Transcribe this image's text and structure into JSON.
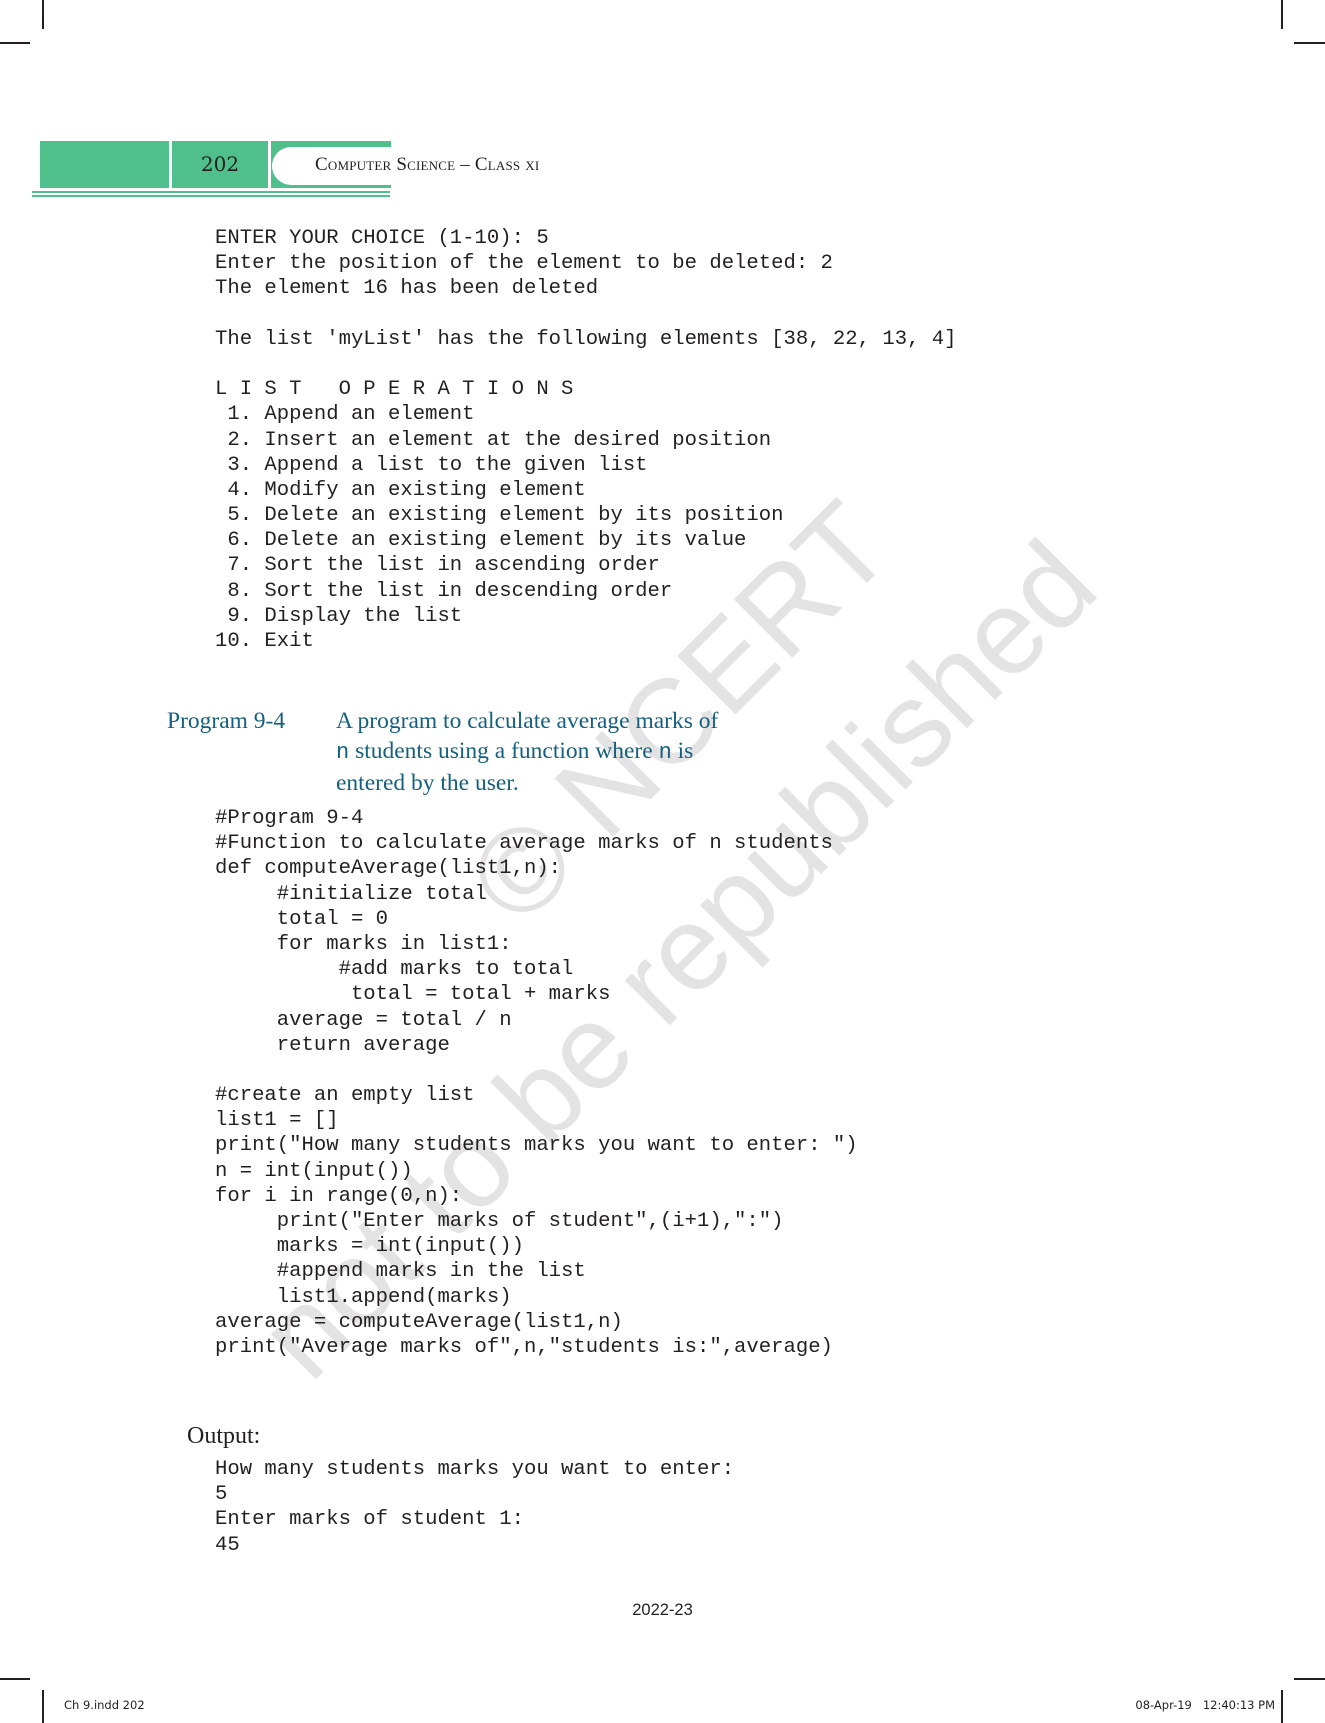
{
  "header": {
    "page_number": "202",
    "running_title": "Computer Science – Class xi",
    "band_color": "#4fbf8c"
  },
  "top_output": {
    "lines": [
      "ENTER YOUR CHOICE (1-10): 5",
      "Enter the position of the element to be deleted: 2",
      "The element 16 has been deleted",
      "",
      "The list 'myList' has the following elements [38, 22, 13, 4]",
      "",
      "L I S T   O P E R A T I O N S",
      " 1. Append an element",
      " 2. Insert an element at the desired position",
      " 3. Append a list to the given list",
      " 4. Modify an existing element",
      " 5. Delete an existing element by its position",
      " 6. Delete an existing element by its value",
      " 7. Sort the list in ascending order",
      " 8. Sort the list in descending order",
      " 9. Display the list",
      "10. Exit"
    ]
  },
  "program": {
    "label": "Program 9-4",
    "caption_color": "#14607f",
    "caption_line1": "A program to calculate average marks of",
    "caption_line2_code1": "n",
    "caption_line2_mid": " students using a function where ",
    "caption_line2_code2": "n",
    "caption_line2_end": " is",
    "caption_line3": "entered by the user."
  },
  "code": {
    "lines": [
      "#Program 9-4",
      "#Function to calculate average marks of n students",
      "def computeAverage(list1,n):",
      "     #initialize total",
      "     total = 0",
      "     for marks in list1:",
      "          #add marks to total",
      "           total = total + marks",
      "     average = total / n",
      "     return average",
      "",
      "#create an empty list",
      "list1 = []",
      "print(\"How many students marks you want to enter: \")",
      "n = int(input())",
      "for i in range(0,n):",
      "     print(\"Enter marks of student\",(i+1),\":\")",
      "     marks = int(input())",
      "     #append marks in the list",
      "     list1.append(marks)",
      "average = computeAverage(list1,n)",
      "print(\"Average marks of\",n,\"students is:\",average)"
    ]
  },
  "output": {
    "heading": "Output:",
    "lines": [
      "How many students marks you want to enter:",
      "5",
      "Enter marks of student 1:",
      "45"
    ]
  },
  "footer": {
    "year": "2022-23",
    "slug_left": "Ch 9.indd   202",
    "slug_right": "08-Apr-19   12:40:13 PM"
  },
  "watermark": {
    "line1": "© NCERT",
    "line2": "not to be republished"
  }
}
